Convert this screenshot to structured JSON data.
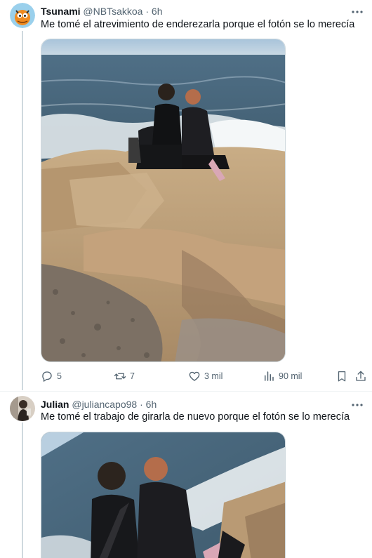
{
  "tweets": [
    {
      "name": "Tsunami",
      "handle": "@NBTsakkoa",
      "time": "6h",
      "text": "Me tomé el atrevimiento de enderezarla porque el fotón se lo merecía",
      "actions": {
        "replies": "5",
        "reposts": "7",
        "likes": "3 mil",
        "views": "90 mil"
      }
    },
    {
      "name": "Julian",
      "handle": "@juliancapo98",
      "time": "6h",
      "text": "Me tomé el trabajo de girarla de nuevo porque el fotón se lo merecía"
    }
  ],
  "separator": "·",
  "icons": [
    "more-icon",
    "reply-icon",
    "repost-icon",
    "like-icon",
    "views-icon",
    "bookmark-icon",
    "share-icon"
  ],
  "colors": {
    "text": "#0f1419",
    "secondary": "#536471",
    "line": "#cfd9de"
  }
}
